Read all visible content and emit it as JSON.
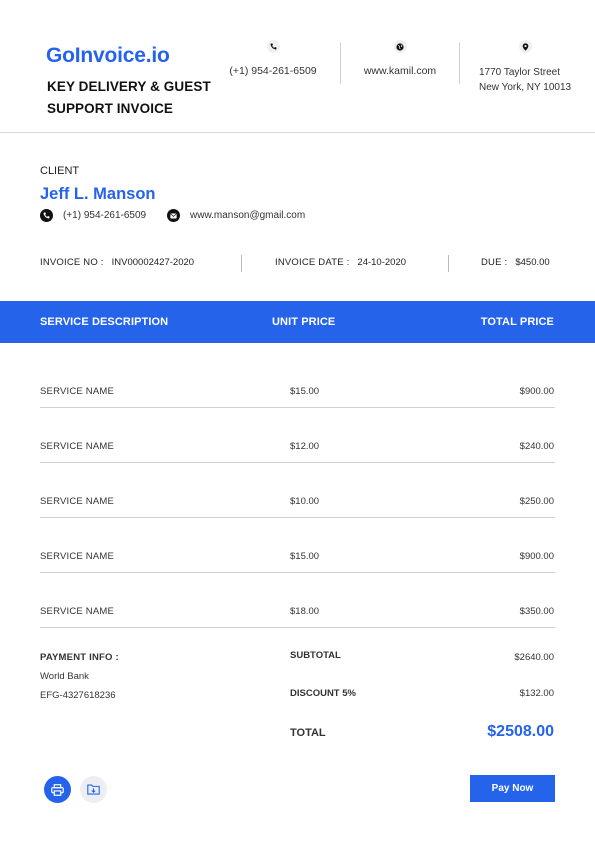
{
  "header": {
    "brand": "GoInvoice.io",
    "title": "KEY DELIVERY & GUEST SUPPORT INVOICE",
    "phone": "(+1) 954-261-6509",
    "website": "www.kamil.com",
    "address_line1": "1770 Taylor Street",
    "address_line2": "New York, NY 10013",
    "icons": [
      "phone-icon",
      "globe-icon",
      "location-pin-icon"
    ]
  },
  "client": {
    "label": "CLIENT",
    "name": "Jeff L. Manson",
    "phone": "(+1) 954-261-6509",
    "email": "www.manson@gmail.com"
  },
  "meta": {
    "invoice_no_label": "INVOICE NO :",
    "invoice_no": "INV00002427-2020",
    "invoice_date_label": "INVOICE DATE :",
    "invoice_date": "24-10-2020",
    "due_label": "DUE :",
    "due": "$450.00"
  },
  "table": {
    "columns": [
      "SERVICE DESCRIPTION",
      "UNIT PRICE",
      "TOTAL PRICE"
    ],
    "rows": [
      {
        "description": "SERVICE NAME",
        "unit_price": "$15.00",
        "total_price": "$900.00"
      },
      {
        "description": "SERVICE NAME",
        "unit_price": "$12.00",
        "total_price": "$240.00"
      },
      {
        "description": "SERVICE NAME",
        "unit_price": "$10.00",
        "total_price": "$250.00"
      },
      {
        "description": "SERVICE NAME",
        "unit_price": "$15.00",
        "total_price": "$900.00"
      },
      {
        "description": "SERVICE NAME",
        "unit_price": "$18.00",
        "total_price": "$350.00"
      }
    ]
  },
  "payment": {
    "label": "PAYMENT INFO :",
    "bank": "World Bank",
    "account": "EFG-4327618236"
  },
  "summary": {
    "subtotal_label": "SUBTOTAL",
    "subtotal": "$2640.00",
    "discount_label": "DISCOUNT 5%",
    "discount": "$132.00",
    "total_label": "TOTAL",
    "total": "$2508.00"
  },
  "actions": {
    "pay_now": "Pay Now",
    "icons": [
      "print-icon",
      "download-folder-icon"
    ]
  },
  "colors": {
    "accent": "#2563eb",
    "divider": "#d0d0d0"
  }
}
